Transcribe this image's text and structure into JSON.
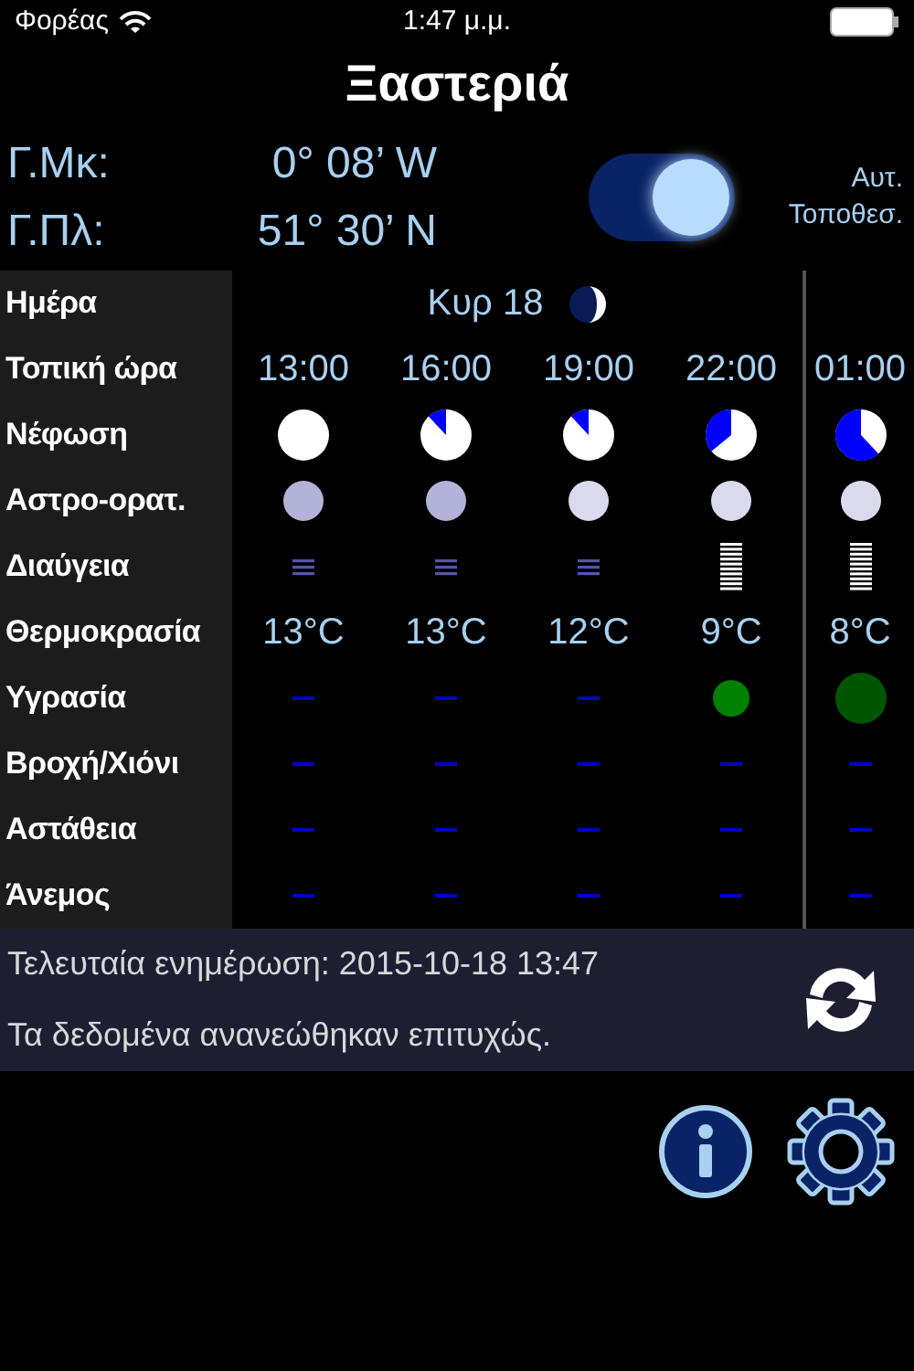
{
  "status_bar": {
    "carrier": "Φορέας",
    "time": "1:47 μ.μ."
  },
  "title": "Ξαστεριά",
  "location": {
    "rows": [
      {
        "label": "Γ.Μκ:",
        "value": "0° 08’ W"
      },
      {
        "label": "Γ.Πλ:",
        "value": "51° 30’ N"
      }
    ],
    "auto": {
      "on": true,
      "lines": [
        "Αυτ.",
        "Τοποθεσ."
      ]
    }
  },
  "grid": {
    "row_labels": [
      "Ημέρα",
      "Τοπική ώρα",
      "Νέφωση",
      "Αστρο-ορατ.",
      "Διαύγεια",
      "Θερμοκρασία",
      "Υγρασία",
      "Βροχή/Χιόνι",
      "Αστάθεια",
      "Άνεμος"
    ],
    "day": "Κυρ 18",
    "columns": [
      {
        "time": "13:00",
        "new_day": false,
        "cloud": {
          "kind": "clear"
        },
        "seeing": {
          "color": "#b3b3d9"
        },
        "transparency": {
          "kind": "low"
        },
        "temperature": "13°C",
        "humidity": {
          "kind": "dash"
        },
        "rain": {
          "kind": "dash"
        },
        "instability": {
          "kind": "dash"
        },
        "wind": {
          "kind": "dash"
        }
      },
      {
        "time": "16:00",
        "new_day": false,
        "cloud": {
          "kind": "slight"
        },
        "seeing": {
          "color": "#b3b3d9"
        },
        "transparency": {
          "kind": "low"
        },
        "temperature": "13°C",
        "humidity": {
          "kind": "dash"
        },
        "rain": {
          "kind": "dash"
        },
        "instability": {
          "kind": "dash"
        },
        "wind": {
          "kind": "dash"
        }
      },
      {
        "time": "19:00",
        "new_day": false,
        "cloud": {
          "kind": "slight"
        },
        "seeing": {
          "color": "#dadaee"
        },
        "transparency": {
          "kind": "low"
        },
        "temperature": "12°C",
        "humidity": {
          "kind": "dash"
        },
        "rain": {
          "kind": "dash"
        },
        "instability": {
          "kind": "dash"
        },
        "wind": {
          "kind": "dash"
        }
      },
      {
        "time": "22:00",
        "new_day": false,
        "cloud": {
          "kind": "partial"
        },
        "seeing": {
          "color": "#dadaee"
        },
        "transparency": {
          "kind": "high"
        },
        "temperature": "9°C",
        "humidity": {
          "kind": "small-dot",
          "color": "#008000"
        },
        "rain": {
          "kind": "dash"
        },
        "instability": {
          "kind": "dash"
        },
        "wind": {
          "kind": "dash"
        }
      },
      {
        "time": "01:00",
        "new_day": true,
        "cloud": {
          "kind": "mostly"
        },
        "seeing": {
          "color": "#dadaee"
        },
        "transparency": {
          "kind": "high"
        },
        "temperature": "8°C",
        "humidity": {
          "kind": "large-dot",
          "color": "#005500"
        },
        "rain": {
          "kind": "dash"
        },
        "instability": {
          "kind": "dash"
        },
        "wind": {
          "kind": "dash"
        }
      }
    ]
  },
  "update_panel": {
    "last_update": "Τελευταία ενημέρωση: 2015-10-18 13:47",
    "message": "Τα δεδομένα ανανεώθηκαν επιτυχώς."
  }
}
